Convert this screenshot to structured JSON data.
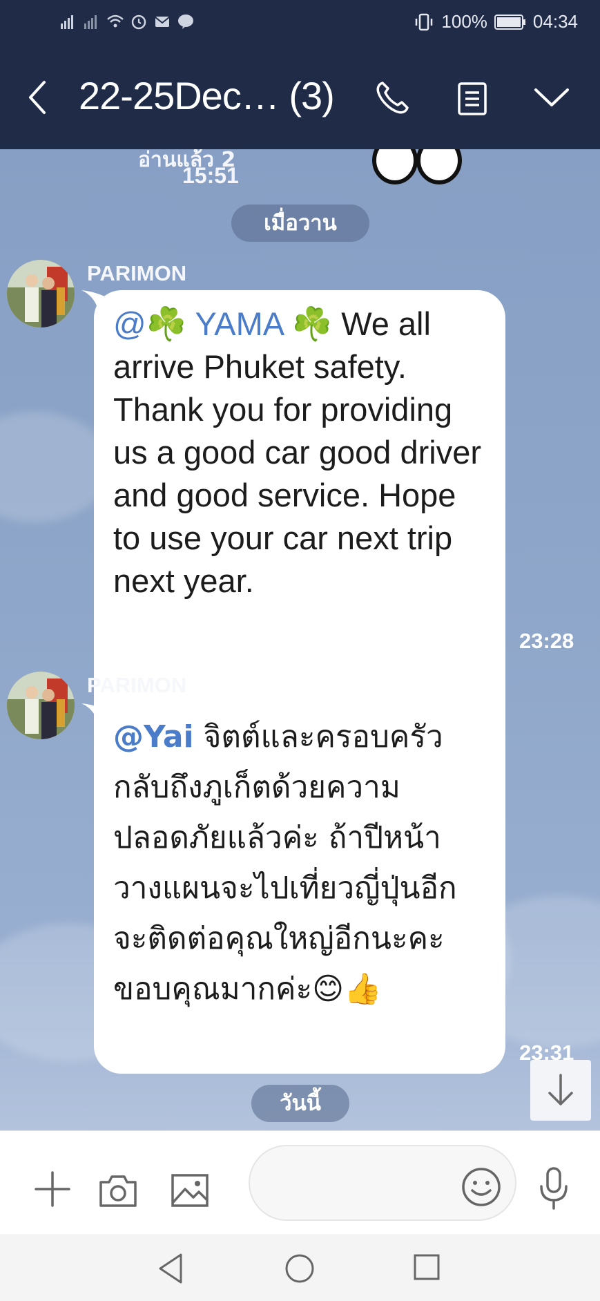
{
  "status_bar": {
    "battery": "100%",
    "time": "04:34",
    "icons": [
      "signal-icon",
      "signal-icon",
      "wifi-icon",
      "alarm-icon",
      "mail-icon",
      "line-icon",
      "vibrate-icon",
      "battery-icon"
    ]
  },
  "header": {
    "title": "22-25Dec… (3)",
    "icons": [
      "back-arrow-icon",
      "phone-icon",
      "notes-icon",
      "chevron-down-icon"
    ]
  },
  "chat": {
    "partial_read_label": "อ่านแล้ว 2",
    "partial_time": "15:51",
    "date_yesterday": "เมื่อวาน",
    "date_today": "วันนี้",
    "messages": [
      {
        "sender": "PARIMON",
        "mention": "@☘️ YAMA ☘️",
        "text": " We all arrive Phuket safety. Thank you for providing us a good car good driver and good service. Hope to use  your car next trip next year.",
        "time": "23:28"
      },
      {
        "sender": "PARIMON",
        "mention": "@Yai",
        "text": " จิตต์และครอบครัวกลับถึงภูเก็ตด้วยความปลอดภัยแล้วค่ะ ถ้าปีหน้าวางแผนจะไปเที่ยวญี่ปุ่นอีกจะติดต่อคุณใหญ่อีกนะคะ ขอบคุณมากค่ะ😊👍",
        "time": "23:31"
      }
    ]
  },
  "input_bar": {
    "placeholder": "",
    "icons": [
      "plus-icon",
      "camera-icon",
      "image-icon",
      "emoji-icon",
      "microphone-icon"
    ]
  },
  "colors": {
    "header_bg": "#1f2b47",
    "mention": "#4a7cc9",
    "chat_bg": "#8ea6c9"
  }
}
